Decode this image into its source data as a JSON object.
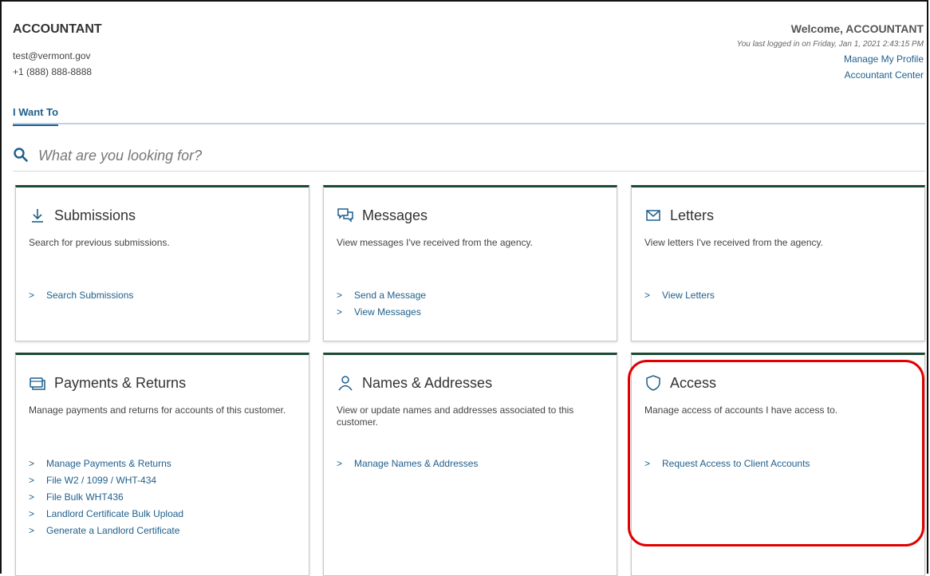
{
  "account": {
    "name": "ACCOUNTANT",
    "email": "test@vermont.gov",
    "phone": "+1 (888) 888-8888"
  },
  "header": {
    "welcome": "Welcome, ACCOUNTANT",
    "last_login": "You last logged in on Friday, Jan 1, 2021 2:43:15 PM",
    "links": [
      "Manage My Profile",
      "Accountant Center"
    ]
  },
  "tabs": [
    {
      "label": "I Want To"
    }
  ],
  "search": {
    "placeholder": "What are you looking for?"
  },
  "cards": [
    {
      "title": "Submissions",
      "icon": "download-icon",
      "desc": "Search for previous submissions.",
      "links": [
        "Search Submissions"
      ]
    },
    {
      "title": "Messages",
      "icon": "chat-icon",
      "desc": "View messages I've received from the agency.",
      "links": [
        "Send a Message",
        "View Messages"
      ]
    },
    {
      "title": "Letters",
      "icon": "envelope-icon",
      "desc": "View letters I've received from the agency.",
      "links": [
        "View Letters"
      ]
    },
    {
      "title": "Payments & Returns",
      "icon": "payments-icon",
      "desc": "Manage payments and returns for accounts of this customer.",
      "links": [
        "Manage Payments & Returns",
        "File W2 / 1099 / WHT-434",
        "File Bulk WHT436",
        "Landlord Certificate Bulk Upload",
        "Generate a Landlord Certificate"
      ]
    },
    {
      "title": "Names & Addresses",
      "icon": "person-icon",
      "desc": "View or update names and addresses associated to this customer.",
      "links": [
        "Manage Names & Addresses"
      ]
    },
    {
      "title": "Access",
      "icon": "shield-icon",
      "desc": "Manage access of accounts I have access to.",
      "links": [
        "Request Access to Client Accounts"
      ]
    }
  ],
  "colors": {
    "link": "#1f5f8b",
    "card_top": "#1d4a33",
    "highlight": "#e00000"
  }
}
